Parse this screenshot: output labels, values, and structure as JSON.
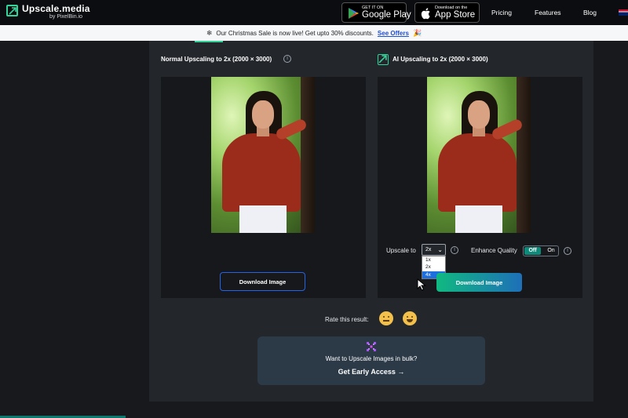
{
  "header": {
    "logo_title": "Upscale.media",
    "logo_sub": "by PixelBin.io",
    "google_play": {
      "small": "GET IT ON",
      "big": "Google Play"
    },
    "app_store": {
      "small": "Download on the",
      "big": "App Store"
    },
    "nav": [
      "Pricing",
      "Features",
      "Blog"
    ]
  },
  "banner": {
    "text": "Our Christmas Sale is now live! Get upto 30% discounts.",
    "link": "See Offers"
  },
  "left": {
    "title": "Normal Upscaling to 2x (2000 × 3000)",
    "download": "Download Image"
  },
  "right": {
    "title": "AI Upscaling to 2x (2000 × 3000)",
    "download": "Download Image",
    "upscale_label": "Upscale to",
    "upscale_value": "2x",
    "upscale_options": [
      "1x",
      "2x",
      "4x"
    ],
    "upscale_highlighted": "4x",
    "enhance_label": "Enhance Quality",
    "toggle_off": "Off",
    "toggle_on": "On",
    "enhance_state": "Off"
  },
  "rating": {
    "label": "Rate this result:"
  },
  "bulk": {
    "text": "Want to Upscale Images in bulk?",
    "cta": "Get Early Access →"
  },
  "colors": {
    "accent": "#34d399",
    "download_gradient_start": "#10b981",
    "download_gradient_end": "#1e6fb8",
    "toggle_active": "#0f8a7a"
  }
}
